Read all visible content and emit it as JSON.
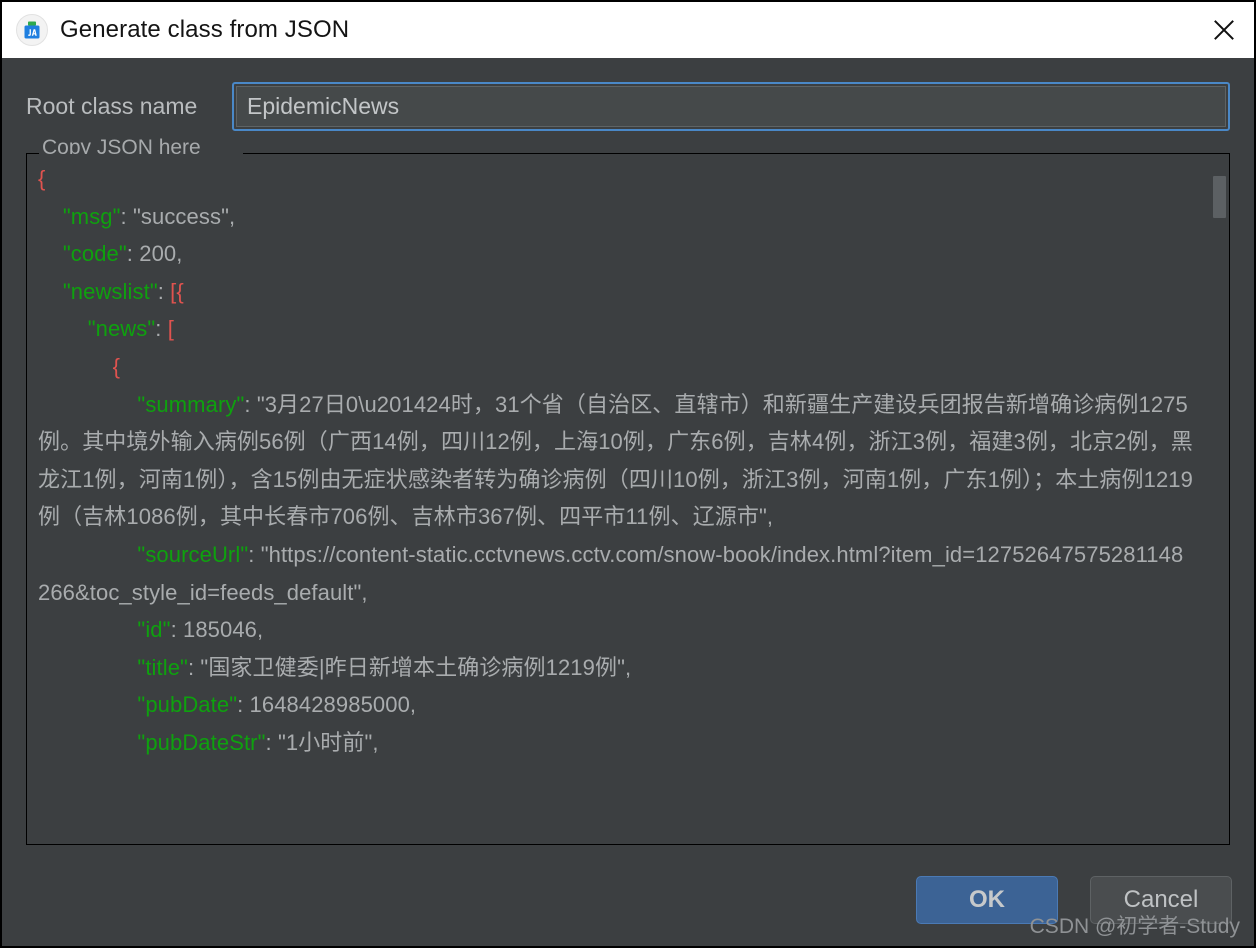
{
  "window": {
    "title": "Generate class from JSON",
    "icon": "json-plugin-icon",
    "close_label": "✕"
  },
  "form": {
    "root_class_label": "Root class name",
    "root_class_value": "EpidemicNews",
    "root_class_placeholder": "EpidemicNews"
  },
  "json_group": {
    "legend": "Copy JSON here",
    "lines": [
      {
        "indent": 0,
        "tokens": [
          {
            "t": "{",
            "c": "p"
          }
        ]
      },
      {
        "indent": 1,
        "tokens": [
          {
            "t": "\"msg\"",
            "c": "k"
          },
          {
            "t": ": ",
            "c": "s"
          },
          {
            "t": "\"success\",",
            "c": "s"
          }
        ]
      },
      {
        "indent": 1,
        "tokens": [
          {
            "t": "\"code\"",
            "c": "k"
          },
          {
            "t": ": ",
            "c": "s"
          },
          {
            "t": "200,",
            "c": "s"
          }
        ]
      },
      {
        "indent": 1,
        "tokens": [
          {
            "t": "\"newslist\"",
            "c": "k"
          },
          {
            "t": ": ",
            "c": "s"
          },
          {
            "t": "[{",
            "c": "p"
          }
        ]
      },
      {
        "indent": 2,
        "tokens": [
          {
            "t": "\"news\"",
            "c": "k"
          },
          {
            "t": ": ",
            "c": "s"
          },
          {
            "t": "[",
            "c": "p"
          }
        ]
      },
      {
        "indent": 3,
        "tokens": [
          {
            "t": "{",
            "c": "p"
          }
        ]
      },
      {
        "indent": 4,
        "tokens": [
          {
            "t": "\"summary\"",
            "c": "k"
          },
          {
            "t": ": ",
            "c": "s"
          },
          {
            "t": "\"3月27日0\\u201424时，31个省（自治区、直辖市）和新疆生产建设兵团报告新增确诊病例1275例。其中境外输入病例56例（广西14例，四川12例，上海10例，广东6例，吉林4例，浙江3例，福建3例，北京2例，黑龙江1例，河南1例），含15例由无症状感染者转为确诊病例（四川10例，浙江3例，河南1例，广东1例）；本土病例1219例（吉林1086例，其中长春市706例、吉林市367例、四平市11例、辽源市\",",
            "c": "s"
          }
        ]
      },
      {
        "indent": 4,
        "tokens": [
          {
            "t": "\"sourceUrl\"",
            "c": "k"
          },
          {
            "t": ": ",
            "c": "s"
          },
          {
            "t": "\"https://content-static.cctvnews.cctv.com/snow-book/index.html?item_id=12752647575281148266&toc_style_id=feeds_default\",",
            "c": "s"
          }
        ]
      },
      {
        "indent": 4,
        "tokens": [
          {
            "t": "\"id\"",
            "c": "k"
          },
          {
            "t": ": ",
            "c": "s"
          },
          {
            "t": "185046,",
            "c": "s"
          }
        ]
      },
      {
        "indent": 4,
        "tokens": [
          {
            "t": "\"title\"",
            "c": "k"
          },
          {
            "t": ": ",
            "c": "s"
          },
          {
            "t": "\"国家卫健委|昨日新增本土确诊病例1219例\",",
            "c": "s"
          }
        ]
      },
      {
        "indent": 4,
        "tokens": [
          {
            "t": "\"pubDate\"",
            "c": "k"
          },
          {
            "t": ": ",
            "c": "s"
          },
          {
            "t": "1648428985000,",
            "c": "s"
          }
        ]
      },
      {
        "indent": 4,
        "tokens": [
          {
            "t": "\"pubDateStr\"",
            "c": "k"
          },
          {
            "t": ": ",
            "c": "s"
          },
          {
            "t": "\"1小时前\",",
            "c": "s"
          }
        ]
      }
    ]
  },
  "footer": {
    "ok_label": "OK",
    "cancel_label": "Cancel"
  },
  "watermark": "CSDN @初学者-Study",
  "colors": {
    "dialog_bg": "#3c3f41",
    "titlebar_bg": "#ffffff",
    "accent_focus": "#4a88c7",
    "ok_button": "#3c6395",
    "json_key": "#0ea10e",
    "json_punct": "#e0534f",
    "json_string": "#a9acae"
  }
}
